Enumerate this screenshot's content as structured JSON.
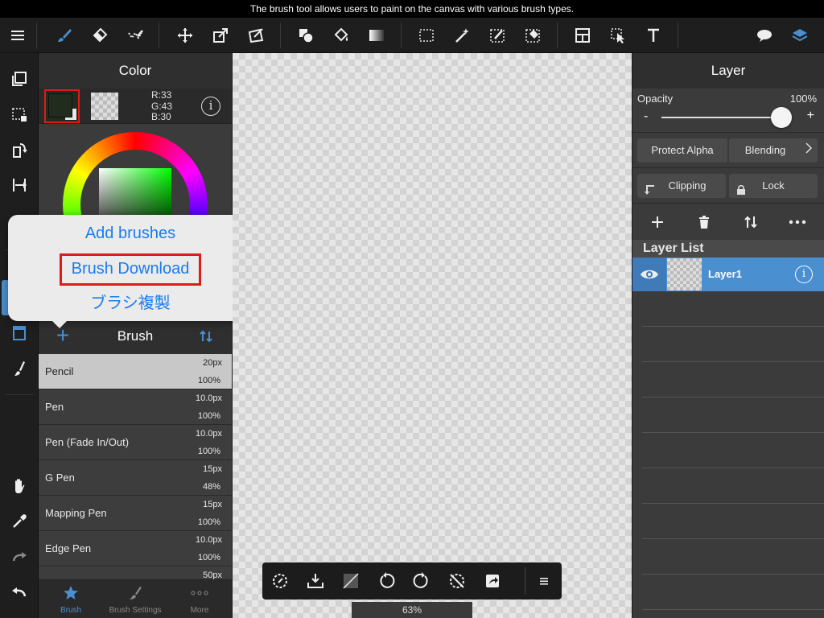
{
  "status_caption": "The brush tool allows users to paint on the canvas with various brush types.",
  "toolbar": {
    "icons": [
      "brush-icon",
      "eraser-icon",
      "smudge-icon",
      "move-icon",
      "transform-icon",
      "deform-icon",
      "shape-icon",
      "fill-icon",
      "gradient-icon",
      "select-rect-icon",
      "magic-wand-icon",
      "select-pen-icon",
      "select-eraser-icon",
      "frame-divide-icon",
      "operation-icon",
      "text-icon",
      "comment-icon",
      "layers-icon"
    ]
  },
  "color_panel": {
    "title": "Color",
    "main_color": "#212b1e",
    "r": "R:33",
    "g": "G:43",
    "b": "B:30",
    "info": "i"
  },
  "popover": {
    "items": [
      "Add brushes",
      "Brush Download",
      "ブラシ複製"
    ]
  },
  "brush_panel": {
    "title": "Brush",
    "add": "+",
    "brushes": [
      {
        "name": "Pencil",
        "size": "20px",
        "opacity": "100%"
      },
      {
        "name": "Pen",
        "size": "10.0px",
        "opacity": "100%"
      },
      {
        "name": "Pen (Fade In/Out)",
        "size": "10.0px",
        "opacity": "100%"
      },
      {
        "name": "G Pen",
        "size": "15px",
        "opacity": "48%"
      },
      {
        "name": "Mapping Pen",
        "size": "15px",
        "opacity": "100%"
      },
      {
        "name": "Edge Pen",
        "size": "10.0px",
        "opacity": "100%"
      },
      {
        "name": "",
        "size": "50px",
        "opacity": ""
      }
    ],
    "tabs": [
      "Brush",
      "Brush Settings",
      "More"
    ]
  },
  "canvas": {
    "zoom": "63%"
  },
  "layer_panel": {
    "title": "Layer",
    "opacity_label": "Opacity",
    "opacity_value": "100%",
    "opacity_fraction": 1.0,
    "minus": "-",
    "plus": "+",
    "protect_alpha": "Protect Alpha",
    "blending": "Blending",
    "clipping": "Clipping",
    "lock": "Lock",
    "layer_list_label": "Layer List",
    "layers": [
      {
        "name": "Layer1",
        "info": "i"
      }
    ]
  },
  "colors": {
    "accent": "#4a8fd0",
    "highlight": "#e01a1a",
    "popover_text": "#1a7cf0"
  }
}
